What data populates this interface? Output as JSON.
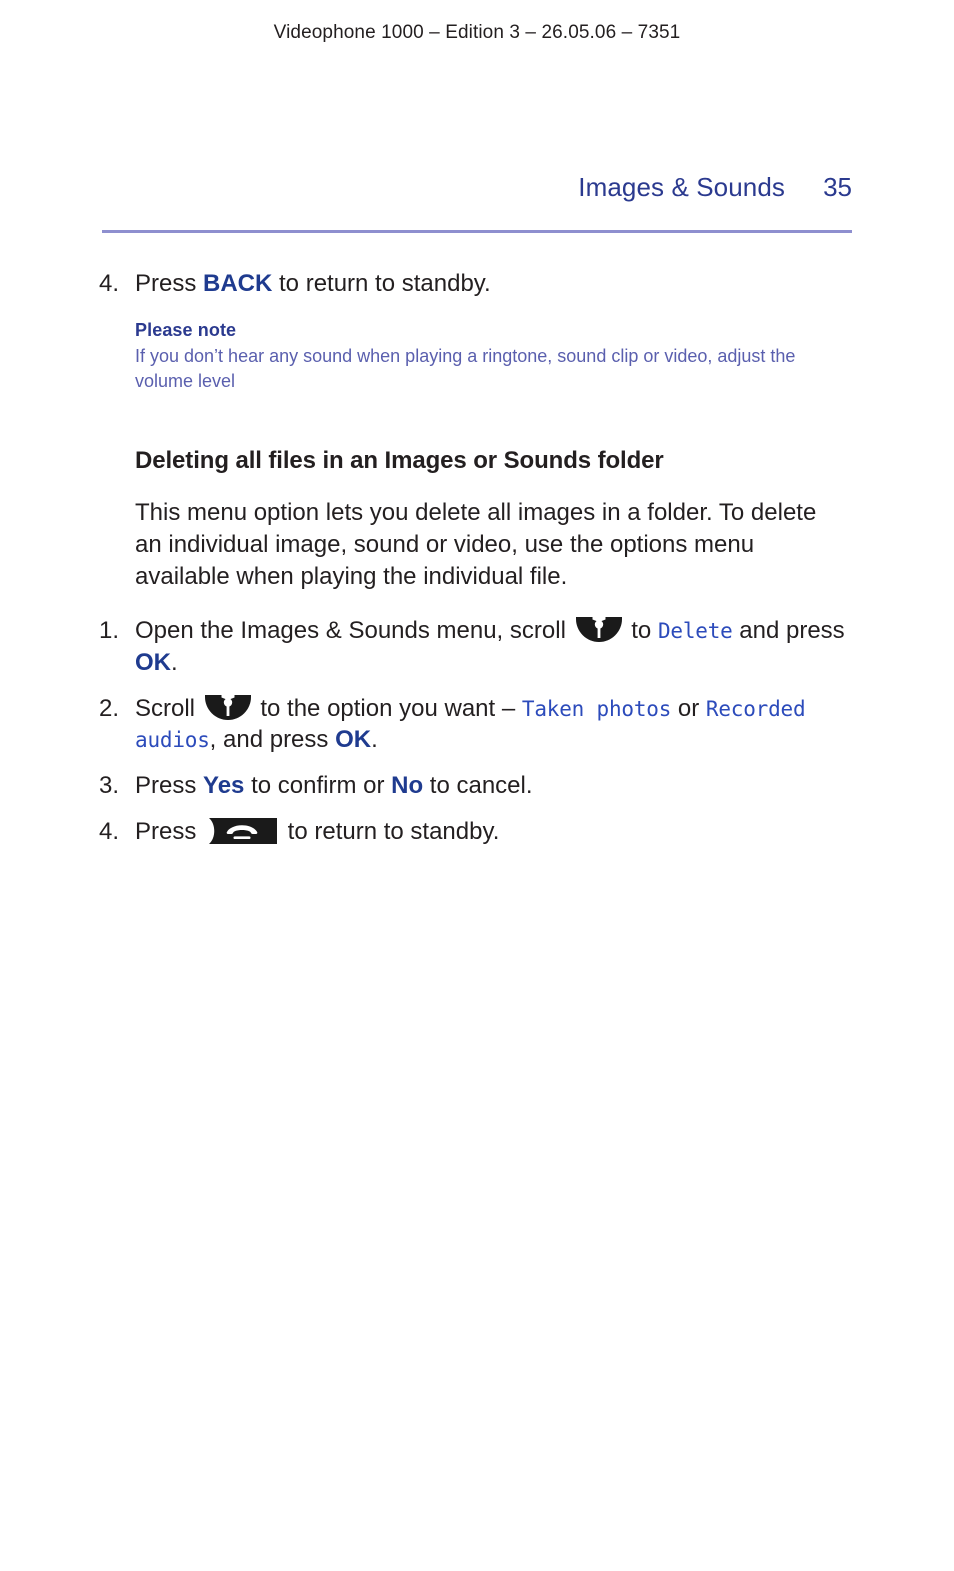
{
  "document": {
    "running_head": "Videophone 1000 – Edition 3 – 26.05.06 – 7351",
    "chapter": "Images & Sounds",
    "page_number": "35"
  },
  "colors": {
    "accent_blue": "#2b3a8f",
    "key_blue": "#1f3b8f",
    "note_body_blue": "#5a5fae",
    "rule_lavender": "#8e8fcf",
    "lcd_blue": "#2c4bbb",
    "text_black": "#231f20"
  },
  "steps_top": [
    {
      "number": "4.",
      "prefix": "Press ",
      "key": "BACK",
      "suffix": " to return to standby."
    }
  ],
  "note": {
    "title": "Please note",
    "body": "If you don’t hear any sound when playing a ringtone, sound clip or video, adjust the volume level"
  },
  "section": {
    "heading": "Deleting all files in an Images or Sounds folder",
    "paragraph": "This menu option lets you delete all images in a folder. To delete an individual image, sound or video, use the options menu available when playing the individual file."
  },
  "procedure": {
    "step1": {
      "number": "1.",
      "part1": "Open the Images & Sounds menu, scroll ",
      "part2": " to ",
      "lcd1": "Delete",
      "part3": " and press ",
      "key1": "OK",
      "part4": "."
    },
    "step2": {
      "number": "2.",
      "part1": "Scroll ",
      "part2": " to the option you want – ",
      "lcd1": "Taken photos",
      "part3": " or ",
      "lcd2": "Recorded audios",
      "part4": ", and press ",
      "key1": "OK",
      "part5": "."
    },
    "step3": {
      "number": "3.",
      "part1": "Press ",
      "key1": "Yes",
      "part2": " to confirm or ",
      "key2": "No",
      "part3": " to cancel."
    },
    "step4": {
      "number": "4.",
      "part1": "Press ",
      "part2": " to return to standby."
    }
  },
  "icons": {
    "scroll": "scroll-key-icon",
    "hangup": "hangup-key-icon"
  }
}
